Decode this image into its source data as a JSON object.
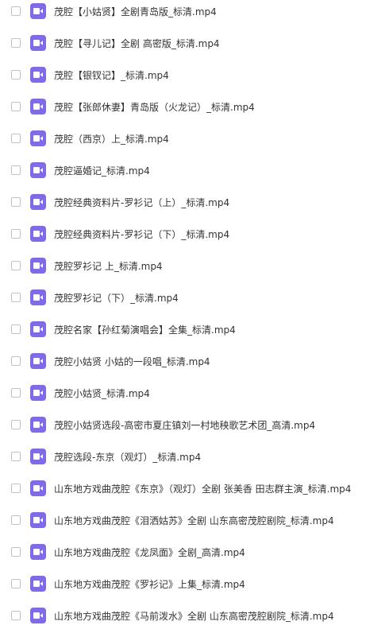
{
  "file_icon_name": "video-file-icon",
  "colors": {
    "icon_bg": "#7f6ae8",
    "text": "#333333",
    "checkbox_border": "#c2c2c2"
  },
  "files": [
    {
      "name": "茂腔【小姑贤】全剧青岛版_标清.mp4"
    },
    {
      "name": "茂腔【寻儿记】全剧 高密版_标清.mp4"
    },
    {
      "name": "茂腔【银钗记】_标清.mp4"
    },
    {
      "name": "茂腔【张郎休妻】青岛版（火龙记）_标清.mp4"
    },
    {
      "name": "茂腔（西京）上_标清.mp4"
    },
    {
      "name": "茂腔逼婚记_标清.mp4"
    },
    {
      "name": "茂腔经典资料片-罗衫记（上）_标清.mp4"
    },
    {
      "name": "茂腔经典资料片-罗衫记（下）_标清.mp4"
    },
    {
      "name": "茂腔罗衫记 上_标清.mp4"
    },
    {
      "name": "茂腔罗衫记（下）_标清.mp4"
    },
    {
      "name": "茂腔名家【孙红菊演唱会】全集_标清.mp4"
    },
    {
      "name": "茂腔小姑贤  小姑的一段唱_标清.mp4"
    },
    {
      "name": "茂腔小姑贤_标清.mp4"
    },
    {
      "name": "茂腔小姑贤选段-高密市夏庄镇刘一村地秧歌艺术团_高清.mp4"
    },
    {
      "name": "茂腔选段-东京（观灯）_标清.mp4"
    },
    {
      "name": "山东地方戏曲茂腔《东京》（观灯）全剧 张美香 田志群主演_标清.mp4"
    },
    {
      "name": "山东地方戏曲茂腔《泪洒姑苏》全剧 山东高密茂腔剧院_标清.mp4"
    },
    {
      "name": "山东地方戏曲茂腔《龙凤面》全剧_高清.mp4"
    },
    {
      "name": "山东地方戏曲茂腔《罗衫记》上集_标清.mp4"
    },
    {
      "name": "山东地方戏曲茂腔《马前泼水》全剧 山东高密茂腔剧院_标清.mp4"
    }
  ]
}
